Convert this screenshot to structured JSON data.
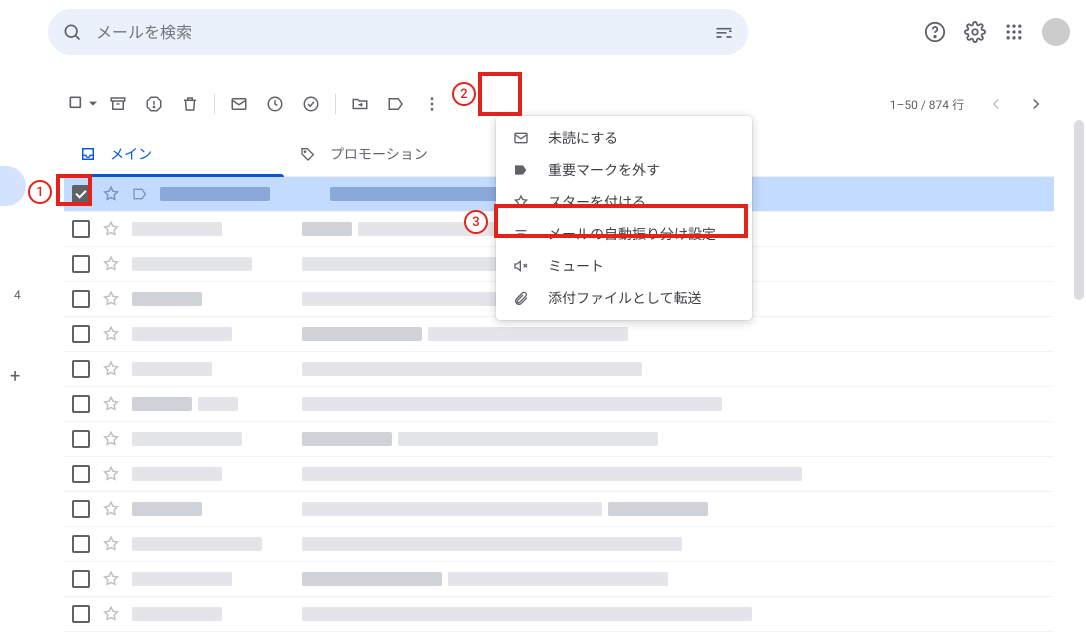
{
  "search": {
    "placeholder": "メールを検索"
  },
  "pagination": {
    "text": "1–50 / 874 行"
  },
  "tabs": [
    {
      "label": "メイン"
    },
    {
      "label": "プロモーション"
    }
  ],
  "menu": {
    "items": [
      {
        "label": "未読にする"
      },
      {
        "label": "重要マークを外す"
      },
      {
        "label": "スターを付ける"
      },
      {
        "label": "メールの自動振り分け設定"
      },
      {
        "label": "ミュート"
      },
      {
        "label": "添付ファイルとして転送"
      }
    ]
  },
  "annotations": {
    "a1": "1",
    "a2": "2",
    "a3": "3"
  },
  "sidebar": {
    "count": "4",
    "plus": "+"
  }
}
